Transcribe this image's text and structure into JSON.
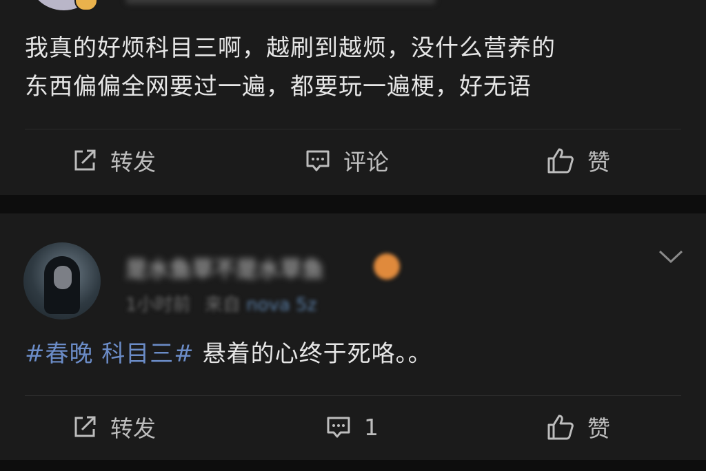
{
  "post1": {
    "line1": "我真的好烦科目三啊，越刷到越烦，没什么营养的",
    "line2": "东西偏偏全网要过一遍，都要玩一遍梗，好无语"
  },
  "post2": {
    "username": "是水鱼草不是水草鱼",
    "time": "1小时前",
    "from_label": "来自",
    "device": "nova 5z",
    "topic": "#春晚 科目三#",
    "text": " 悬着的心终于死咯。。"
  },
  "actions": {
    "repost": "转发",
    "comment": "评论",
    "like": "赞",
    "comment_count": "1"
  },
  "icons": [
    "repost-icon",
    "comment-icon",
    "like-icon",
    "chevron-down-icon"
  ],
  "colors": {
    "background": "#0d0d0d",
    "card": "#1b1b1b",
    "text": "#e6e6e6",
    "topic": "#6b8cc7",
    "vip_badge": "#e9b24c"
  }
}
